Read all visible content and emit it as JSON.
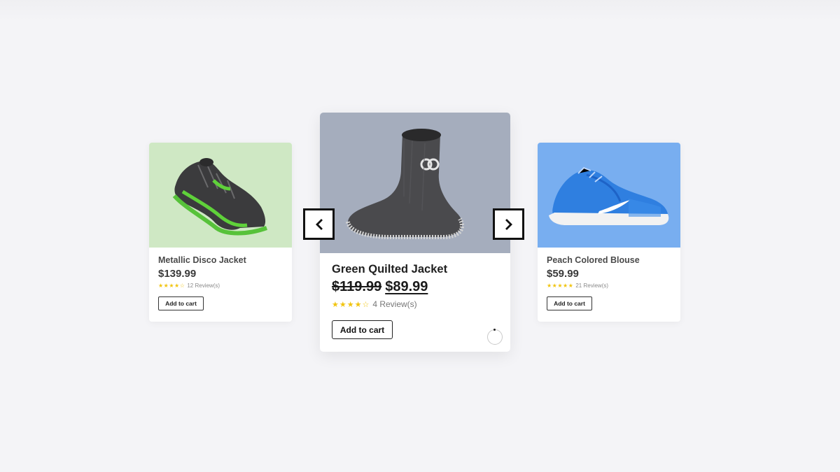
{
  "carousel": {
    "prev_icon": "chevron-left-icon",
    "next_icon": "chevron-right-icon",
    "products": [
      {
        "name": "Metallic Disco Jacket",
        "price": "$139.99",
        "stars": "★★★★☆",
        "reviews": "12 Review(s)",
        "cart_label": "Add to cart",
        "image_bg": "#cfe8c4",
        "image": "green-black-running-shoe"
      },
      {
        "name": "Green Quilted Jacket",
        "old_price": "$119.99",
        "price": "$89.99",
        "stars": "★★★★☆",
        "reviews": "4 Review(s)",
        "cart_label": "Add to cart",
        "image_bg": "#a5adbd",
        "image": "grey-knit-sock-shoe"
      },
      {
        "name": "Peach Colored Blouse",
        "price": "$59.99",
        "stars": "★★★★★",
        "reviews": "21 Review(s)",
        "cart_label": "Add to cart",
        "image_bg": "#78aef0",
        "image": "blue-nike-sneaker"
      }
    ]
  },
  "colors": {
    "page_bg": "#f4f4f7",
    "star": "#f1c40f",
    "text_dark": "#1f1f1f"
  }
}
